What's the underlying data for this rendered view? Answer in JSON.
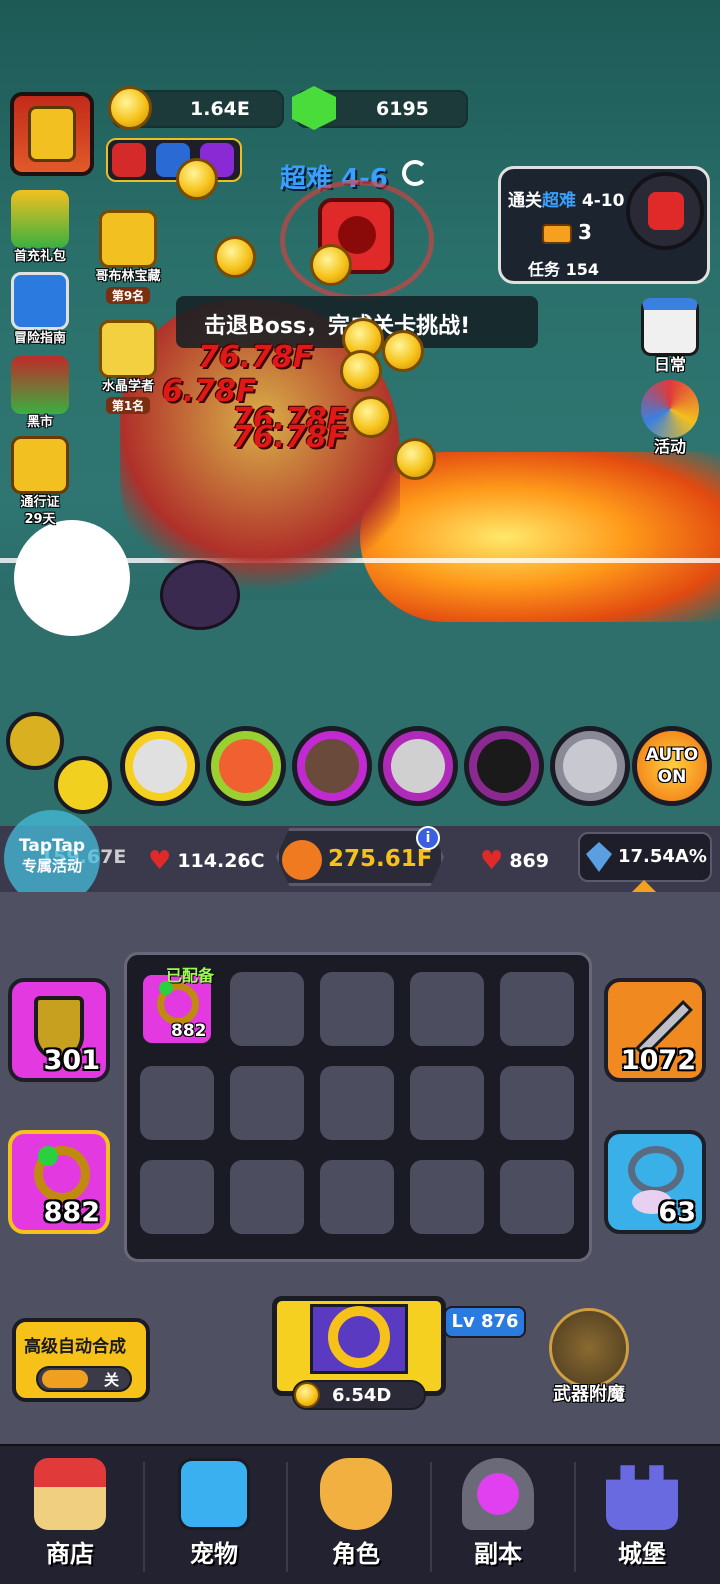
{
  "hud": {
    "gold": "1.64E",
    "gems": "6195",
    "stage": "超难 4-6",
    "boss_prompt": "击退Boss，完成关卡挑战!",
    "quest": {
      "prefix": "通关",
      "difficulty": "超难",
      "level": "4-10",
      "tickets": "3",
      "task": "任务 154"
    }
  },
  "left_menu": [
    {
      "label": "首充礼包",
      "rank": ""
    },
    {
      "label": "冒险指南",
      "rank": ""
    },
    {
      "label": "黑市",
      "rank": ""
    },
    {
      "label": "通行证",
      "sub": "29天"
    }
  ],
  "events": [
    {
      "label": "哥布林宝藏",
      "rank": "第9名"
    },
    {
      "label": "水晶学者",
      "rank": "第1名"
    }
  ],
  "right_menu": [
    {
      "label": "日常"
    },
    {
      "label": "活动"
    }
  ],
  "damage_numbers": [
    "76.78F",
    "6.78F",
    "76.78F",
    "76.78F"
  ],
  "auto_button": {
    "line1": "AUTO",
    "line2": "ON"
  },
  "stats": {
    "taptap": {
      "line1": "TapTap",
      "line2": "专属活动"
    },
    "hidden_stat": "159.67E",
    "hp": "114.26C",
    "attack": "275.61F",
    "regen": "869",
    "crit": "17.54A%"
  },
  "equipment": {
    "equipped_tag": "已配备",
    "equipped_item_level": "882",
    "shield_level": "301",
    "ring_level": "882",
    "sword_level": "1072",
    "necklace_level": "63"
  },
  "auto_merge": {
    "title": "高级自动合成",
    "toggle": "关"
  },
  "chest": {
    "level": "Lv 876",
    "cost": "6.54D"
  },
  "enchant": {
    "label": "武器附魔"
  },
  "nav": [
    {
      "label": "商店"
    },
    {
      "label": "宠物"
    },
    {
      "label": "角色"
    },
    {
      "label": "副本"
    },
    {
      "label": "城堡"
    }
  ],
  "colors": {
    "accent_gold": "#f6c21a",
    "damage_red": "#e01818",
    "skill_magenta": "#c02ad0",
    "panel_bg": "#505063"
  }
}
